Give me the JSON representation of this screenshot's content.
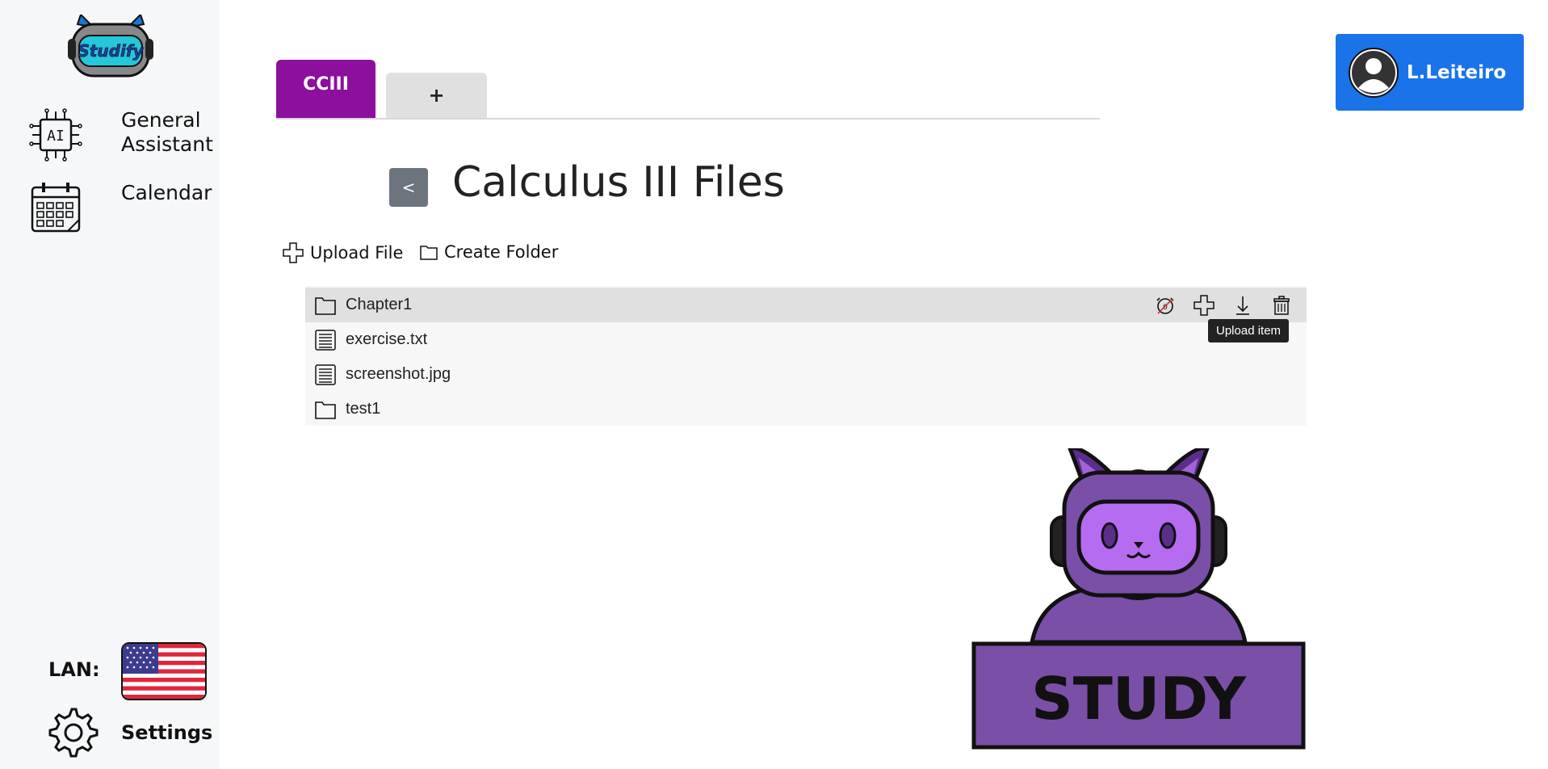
{
  "sidebar": {
    "logo_text": "Studify",
    "items": [
      {
        "label_line1": "General",
        "label_line2": "Assistant",
        "icon": "ai-chip-icon"
      },
      {
        "label": "Calendar",
        "icon": "calendar-icon"
      }
    ],
    "lan_label": "LAN:",
    "language_flag": "us-flag-icon",
    "settings_label": "Settings"
  },
  "tabs": [
    {
      "label": "CCIII",
      "active": true
    },
    {
      "label": "+",
      "active": false
    }
  ],
  "account": {
    "name": "L.Leiteiro",
    "icon": "user-avatar-icon"
  },
  "header": {
    "back_label": "<",
    "title": "Calculus III Files"
  },
  "actions": {
    "upload_label": "Upload File",
    "create_folder_label": "Create Folder"
  },
  "files": [
    {
      "name": "Chapter1",
      "type": "folder"
    },
    {
      "name": "exercise.txt",
      "type": "file"
    },
    {
      "name": "screenshot.jpg",
      "type": "file"
    },
    {
      "name": "test1",
      "type": "folder"
    }
  ],
  "row_actions": [
    "timer-off-icon",
    "plus-icon",
    "download-icon",
    "trash-icon"
  ],
  "tooltip": "Upload item",
  "mascot": {
    "sign_text": "STUDY"
  },
  "colors": {
    "tab_active": "#8d0f9e",
    "account_bg": "#1a73e8",
    "back_btn": "#6c757d",
    "mascot_purple": "#7a4fa8"
  }
}
